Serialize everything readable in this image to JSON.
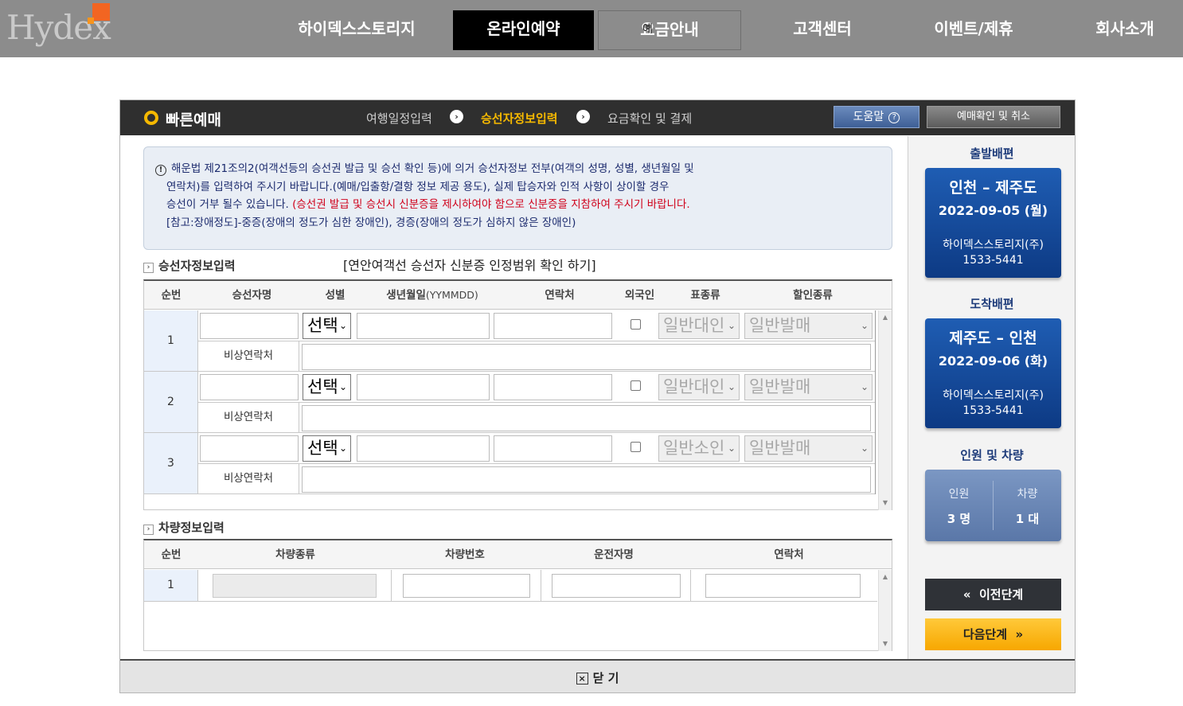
{
  "nav": {
    "logo": "Hydex",
    "items": [
      "하이덱스스토리지",
      "온라인예약",
      "요금안내",
      "고객센터",
      "이벤트/제휴",
      "회사소개"
    ],
    "overlap_text": "예"
  },
  "header": {
    "title": "빠른예매",
    "steps": [
      "여행일정입력",
      "승선자정보입력",
      "요금확인 및 결제"
    ],
    "help_label": "도움말",
    "confirm_label": "예매확인 및 취소"
  },
  "notice": {
    "icon": "!",
    "line1": "해운법 제21조의2(여객선등의 승선권 발급 및 승선 확인 등)에 의거 승선자정보 전부(여객의 성명, 성별, 생년월일 및",
    "line2": "연락처)를 입력하여 주시기 바랍니다.(예매/입출항/결항 정보 제공 용도), 실제 탑승자와 인적 사항이 상이할 경우",
    "line3": "승선이 거부 될수 있습니다.",
    "line3_red": "(승선권 발급 및 승선시 신분증을 제시하여야 함으로 신분증을 지참하여 주시기 바랍니다.",
    "line4": "[참고:장애정도]-중증(장애의 정도가 심한 장애인), 경증(장애의 정도가 심하지 않은 장애인)"
  },
  "passenger_section": {
    "title": "승선자정보입력",
    "link": "[연안여객선 승선자 신분증 인정범위 확인 하기]",
    "headers": {
      "no": "순번",
      "name": "승선자명",
      "gender": "성별",
      "birth": "생년월일",
      "birth_fmt": "(YYMMDD)",
      "phone": "연락처",
      "foreign": "외국인",
      "ticket": "표종류",
      "discount": "할인종류"
    },
    "emergency_label": "비상연락처",
    "rows": [
      {
        "no": "1",
        "gender": "선택",
        "ticket": "일반대인",
        "discount": "일반발매",
        "foreign": false
      },
      {
        "no": "2",
        "gender": "선택",
        "ticket": "일반대인",
        "discount": "일반발매",
        "foreign": false
      },
      {
        "no": "3",
        "gender": "선택",
        "ticket": "일반소인",
        "discount": "일반발매",
        "foreign": false
      }
    ]
  },
  "vehicle_section": {
    "title": "차량정보입력",
    "headers": {
      "no": "순번",
      "type": "차량종류",
      "plate": "차량번호",
      "driver": "운전자명",
      "phone": "연락처"
    },
    "rows": [
      {
        "no": "1"
      }
    ]
  },
  "sidebar": {
    "departure_title": "출발배편",
    "departure": {
      "route": "인천 – 제주도",
      "date": "2022-09-05 (월)",
      "company": "하이덱스스토리지(주)",
      "phone": "1533-5441"
    },
    "arrival_title": "도착배편",
    "arrival": {
      "route": "제주도 – 인천",
      "date": "2022-09-06 (화)",
      "company": "하이덱스스토리지(주)",
      "phone": "1533-5441"
    },
    "people_title": "인원 및 차량",
    "people_label": "인원",
    "people_value": "3 명",
    "vehicle_label": "차량",
    "vehicle_value": "1 대",
    "prev_label": "이전단계",
    "next_label": "다음단계"
  },
  "close_label": "닫 기",
  "colors": {
    "accent": "#f5b800",
    "brand_blue": "#0d3a84",
    "nav_bg": "#8c8c8c",
    "notice_red": "#d0021b"
  }
}
